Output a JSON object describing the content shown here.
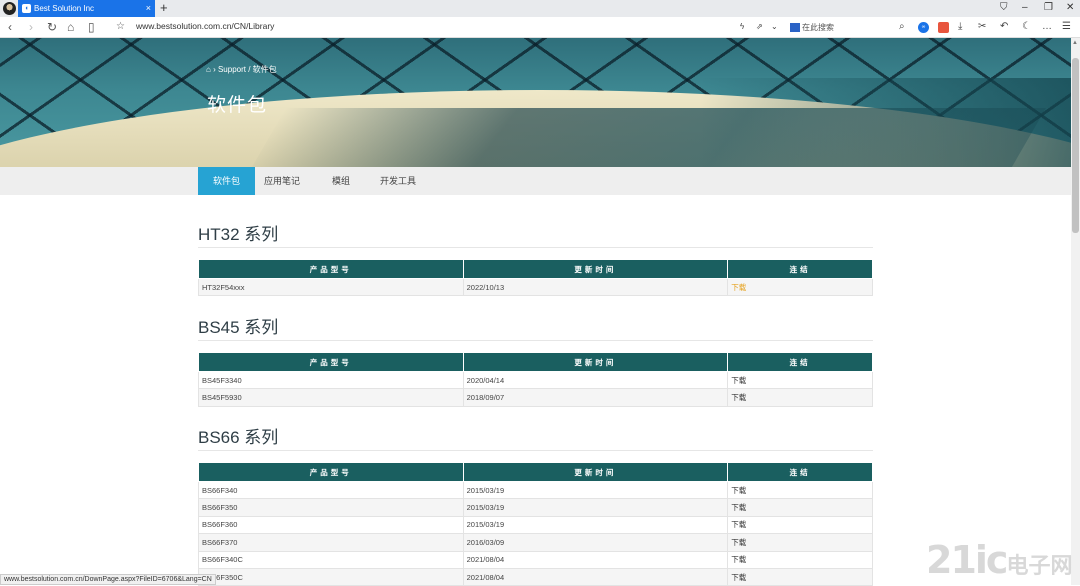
{
  "browser": {
    "tab_title": "Best Solution Inc",
    "tab_close": "×",
    "new_tab": "+",
    "url": "www.bestsolution.com.cn/CN/Library",
    "search_placeholder": "在此搜索",
    "status_url": "www.bestsolution.com.cn/DownPage.aspx?FileID=6706&Lang=CN"
  },
  "hero": {
    "breadcrumb": "Support / 软件包",
    "title": "软件包"
  },
  "subnav": [
    "软件包",
    "应用笔记",
    "模组",
    "开发工具"
  ],
  "columns": [
    "产品型号",
    "更新时间",
    "连结"
  ],
  "sections": [
    {
      "title": "HT32 系列",
      "rows": [
        {
          "model": "HT32F54xxx",
          "date": "2022/10/13",
          "link": "下载"
        }
      ]
    },
    {
      "title": "BS45 系列",
      "rows": [
        {
          "model": "BS45F3340",
          "date": "2020/04/14",
          "link": "下载"
        },
        {
          "model": "BS45F5930",
          "date": "2018/09/07",
          "link": "下载"
        }
      ]
    },
    {
      "title": "BS66 系列",
      "rows": [
        {
          "model": "BS66F340",
          "date": "2015/03/19",
          "link": "下载"
        },
        {
          "model": "BS66F350",
          "date": "2015/03/19",
          "link": "下载"
        },
        {
          "model": "BS66F360",
          "date": "2015/03/19",
          "link": "下载"
        },
        {
          "model": "BS66F370",
          "date": "2016/03/09",
          "link": "下载"
        },
        {
          "model": "BS66F340C",
          "date": "2021/08/04",
          "link": "下载"
        },
        {
          "model": "BS66F350C",
          "date": "2021/08/04",
          "link": "下载"
        }
      ]
    }
  ],
  "watermark": {
    "main": "21ic",
    "sub": "电子网"
  },
  "colors": {
    "header_teal": "#1a5f60",
    "active_tab": "#26a3d3",
    "hot_link": "#e6a11c"
  }
}
